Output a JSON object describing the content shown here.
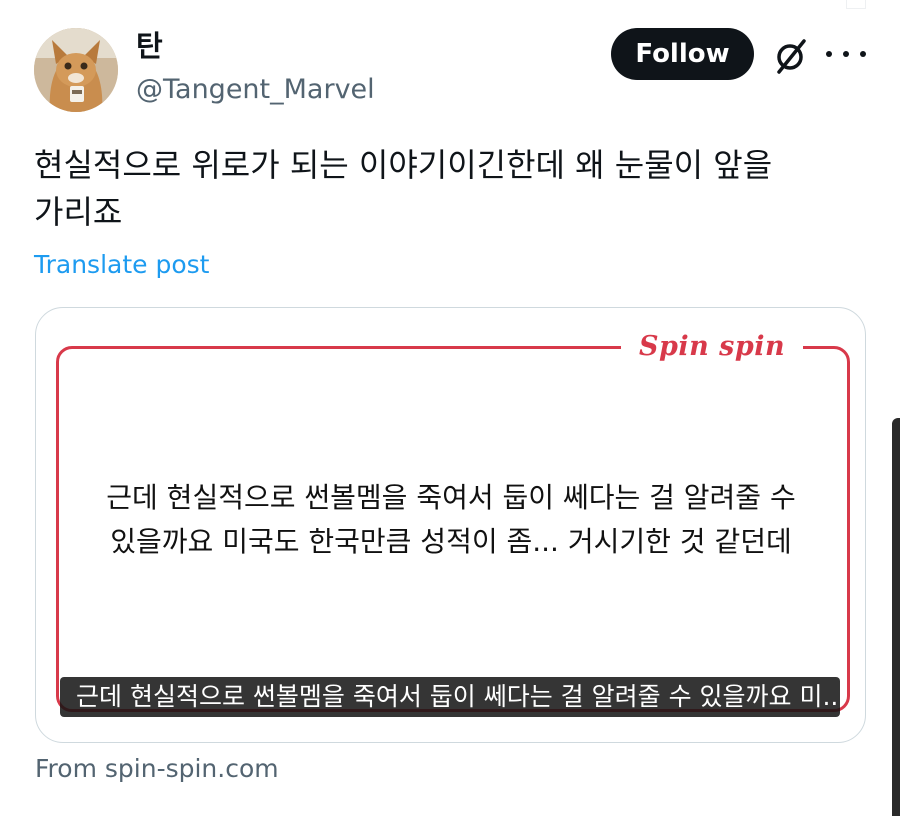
{
  "author": {
    "display_name": "탄",
    "handle": "@Tangent_Marvel",
    "avatar_icon": "cat-avatar-icon"
  },
  "actions": {
    "follow_label": "Follow",
    "grok_icon": "grok-slash-icon",
    "more_icon": "more-dots-icon"
  },
  "post": {
    "text": "현실적으로 위로가 되는 이야기이긴한데 왜 눈물이 앞을 가리죠",
    "translate_label": "Translate post"
  },
  "media": {
    "brand": "Spin spin",
    "quote": "근데 현실적으로 썬볼멤을 죽여서 둡이 쎄다는 걸 알려줄 수 있을까요 미국도 한국만큼 성적이 좀... 거시기한 것 같던데",
    "caption": "근데 현실적으로 썬볼멤을 죽여서 둡이 쎄다는 걸 알려줄 수 있을까요 미...",
    "accent_color": "#d8394a"
  },
  "link": {
    "source_label": "From spin-spin.com"
  },
  "colors": {
    "text_primary": "#0f1419",
    "text_secondary": "#536471",
    "link_blue": "#1d9bf0",
    "button_dark": "#0f1419"
  }
}
